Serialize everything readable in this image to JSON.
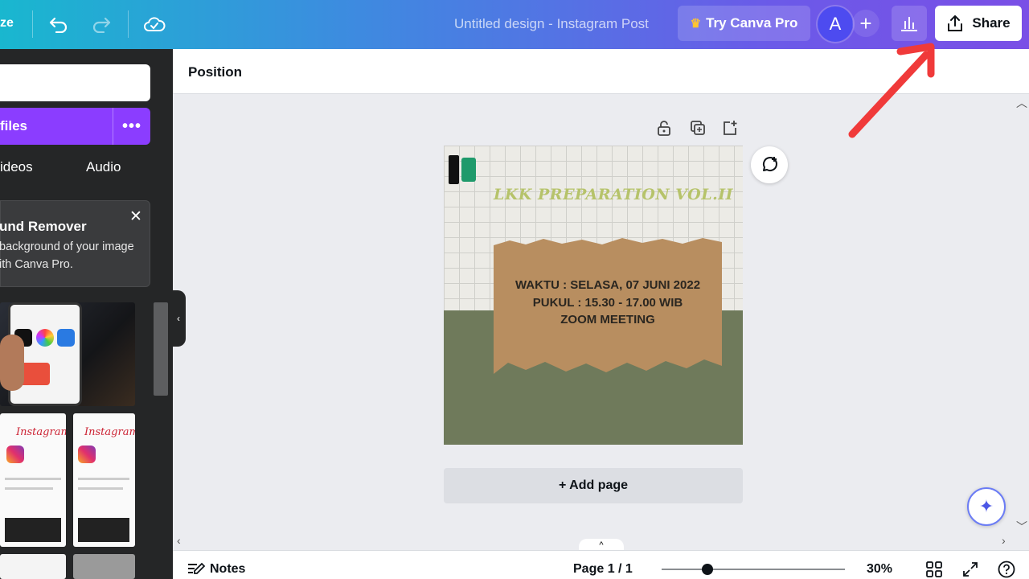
{
  "topbar": {
    "resize_label": "ze",
    "doc_title": "Untitled design - Instagram Post",
    "try_pro_label": "Try Canva Pro",
    "avatar_initial": "A",
    "share_label": "Share"
  },
  "sidebar": {
    "upload_label": "files",
    "upload_more": "•••",
    "tabs": [
      "ideos",
      "Audio"
    ],
    "promo": {
      "title": "und Remover",
      "body_line1": "background of your image",
      "body_line2": "ith Canva Pro.",
      "close": "✕"
    }
  },
  "properties": {
    "position_label": "Position"
  },
  "design": {
    "title": "LKK PREPARATION VOL.II",
    "line1": "WAKTU : SELASA, 07 JUNI 2022",
    "line2": "PUKUL  : 15.30 - 17.00 WIB",
    "line3": "ZOOM MEETING"
  },
  "canvas": {
    "add_page_label": "+ Add page"
  },
  "footer": {
    "notes_label": "Notes",
    "page_indicator": "Page 1 / 1",
    "zoom": "30%",
    "zoom_fraction": 0.25
  },
  "colors": {
    "accent_purple": "#8b3dff",
    "annotation_arrow": "#f03a3a"
  }
}
